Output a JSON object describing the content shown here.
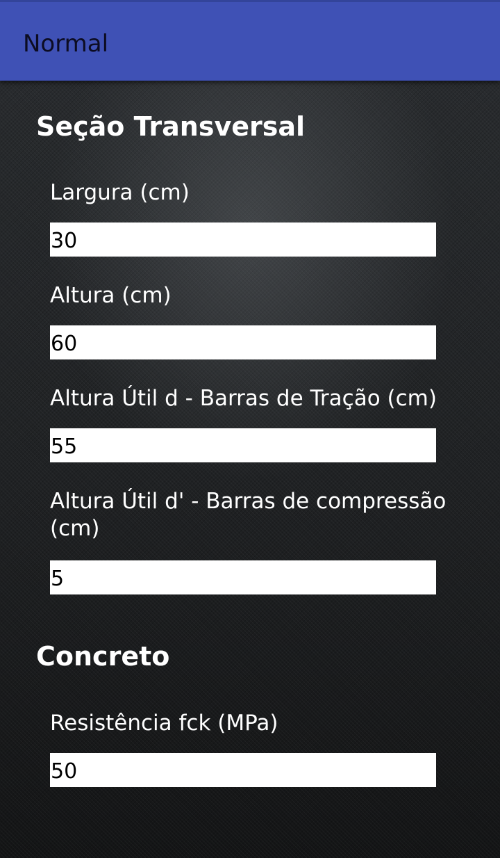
{
  "app_bar": {
    "title": "Normal",
    "background_color": "#3f51b5"
  },
  "sections": [
    {
      "title": "Seção Transversal",
      "fields": [
        {
          "label": "Largura (cm)",
          "value": "30"
        },
        {
          "label": "Altura (cm)",
          "value": "60"
        },
        {
          "label": "Altura Útil d - Barras de Tração (cm)",
          "value": "55"
        },
        {
          "label": "Altura Útil d' - Barras de compressão (cm)",
          "value": "5"
        }
      ]
    },
    {
      "title": "Concreto",
      "fields": [
        {
          "label": "Resistência fck (MPa)",
          "value": "50"
        }
      ]
    }
  ]
}
